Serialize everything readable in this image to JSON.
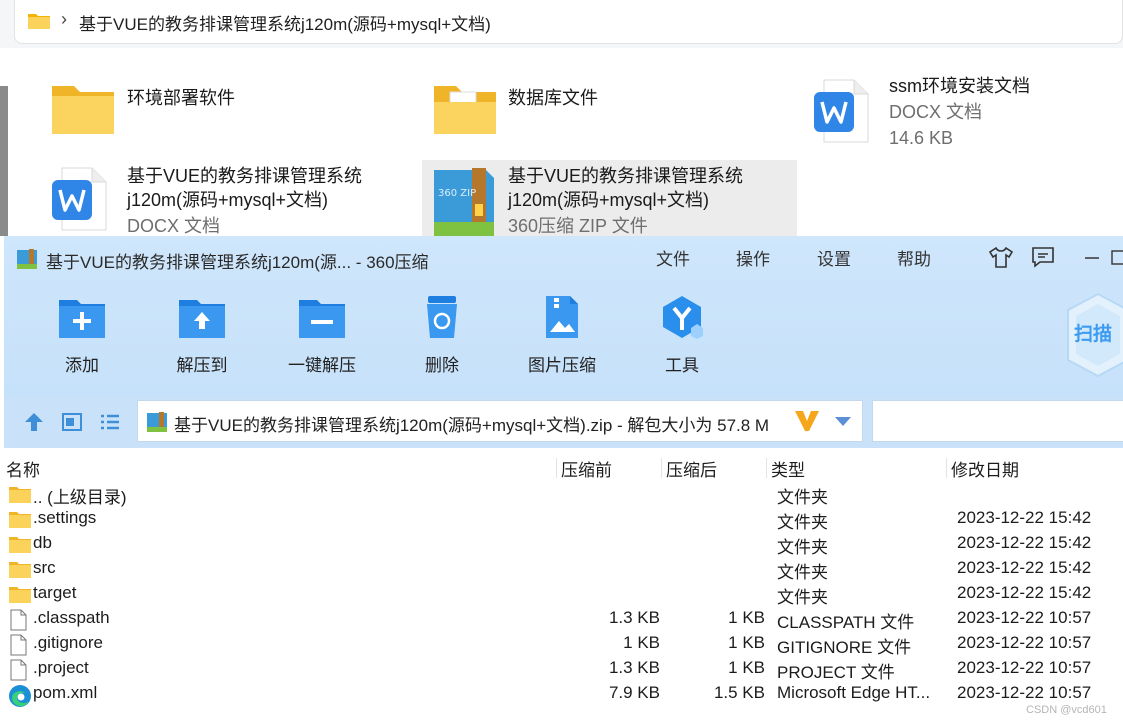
{
  "explorer": {
    "breadcrumb": "基于VUE的教务排课管理系统j120m(源码+mysql+文档)",
    "items": [
      {
        "name_lines": [
          "环境部署软件"
        ]
      },
      {
        "name_lines": [
          "数据库文件"
        ]
      },
      {
        "name_lines": [
          "ssm环境安装文档"
        ],
        "type": "DOCX 文档",
        "size": "14.6 KB"
      },
      {
        "name_lines": [
          "基于VUE的教务排课管理系统",
          "j120m(源码+mysql+文档)"
        ],
        "type": "DOCX 文档"
      },
      {
        "name_lines": [
          "基于VUE的教务排课管理系统",
          "j120m(源码+mysql+文档)"
        ],
        "type": "360压缩 ZIP 文件",
        "zip_badge": "360 ZIP"
      }
    ]
  },
  "zipwin": {
    "title": "基于VUE的教务排课管理系统j120m(源... - 360压缩",
    "menus": [
      "文件",
      "操作",
      "设置",
      "帮助"
    ],
    "toolbar": [
      "添加",
      "解压到",
      "一键解压",
      "删除",
      "图片压缩",
      "工具"
    ],
    "scan_label": "扫描",
    "path": "基于VUE的教务排课管理系统j120m(源码+mysql+文档).zip - 解包大小为 57.8 M",
    "columns": [
      "名称",
      "压缩前",
      "压缩后",
      "类型",
      "修改日期"
    ],
    "rows": [
      {
        "name": ".. (上级目录)",
        "before": "",
        "after": "",
        "type": "文件夹",
        "date": "",
        "icon": "folder"
      },
      {
        "name": ".settings",
        "before": "",
        "after": "",
        "type": "文件夹",
        "date": "2023-12-22 15:42",
        "icon": "folder"
      },
      {
        "name": "db",
        "before": "",
        "after": "",
        "type": "文件夹",
        "date": "2023-12-22 15:42",
        "icon": "folder"
      },
      {
        "name": "src",
        "before": "",
        "after": "",
        "type": "文件夹",
        "date": "2023-12-22 15:42",
        "icon": "folder"
      },
      {
        "name": "target",
        "before": "",
        "after": "",
        "type": "文件夹",
        "date": "2023-12-22 15:42",
        "icon": "folder"
      },
      {
        "name": ".classpath",
        "before": "1.3 KB",
        "after": "1 KB",
        "type": "CLASSPATH 文件",
        "date": "2023-12-22 10:57",
        "icon": "file"
      },
      {
        "name": ".gitignore",
        "before": "1 KB",
        "after": "1 KB",
        "type": "GITIGNORE 文件",
        "date": "2023-12-22 10:57",
        "icon": "file"
      },
      {
        "name": ".project",
        "before": "1.3 KB",
        "after": "1 KB",
        "type": "PROJECT 文件",
        "date": "2023-12-22 10:57",
        "icon": "file"
      },
      {
        "name": "pom.xml",
        "before": "7.9 KB",
        "after": "1.5 KB",
        "type": "Microsoft Edge HT...",
        "date": "2023-12-22 10:57",
        "icon": "edge"
      }
    ]
  },
  "watermark": "CSDN @vcd601",
  "colors": {
    "accent": "#2f86e6",
    "window_top": "#cfe6fb",
    "folder": "#f7c948"
  }
}
